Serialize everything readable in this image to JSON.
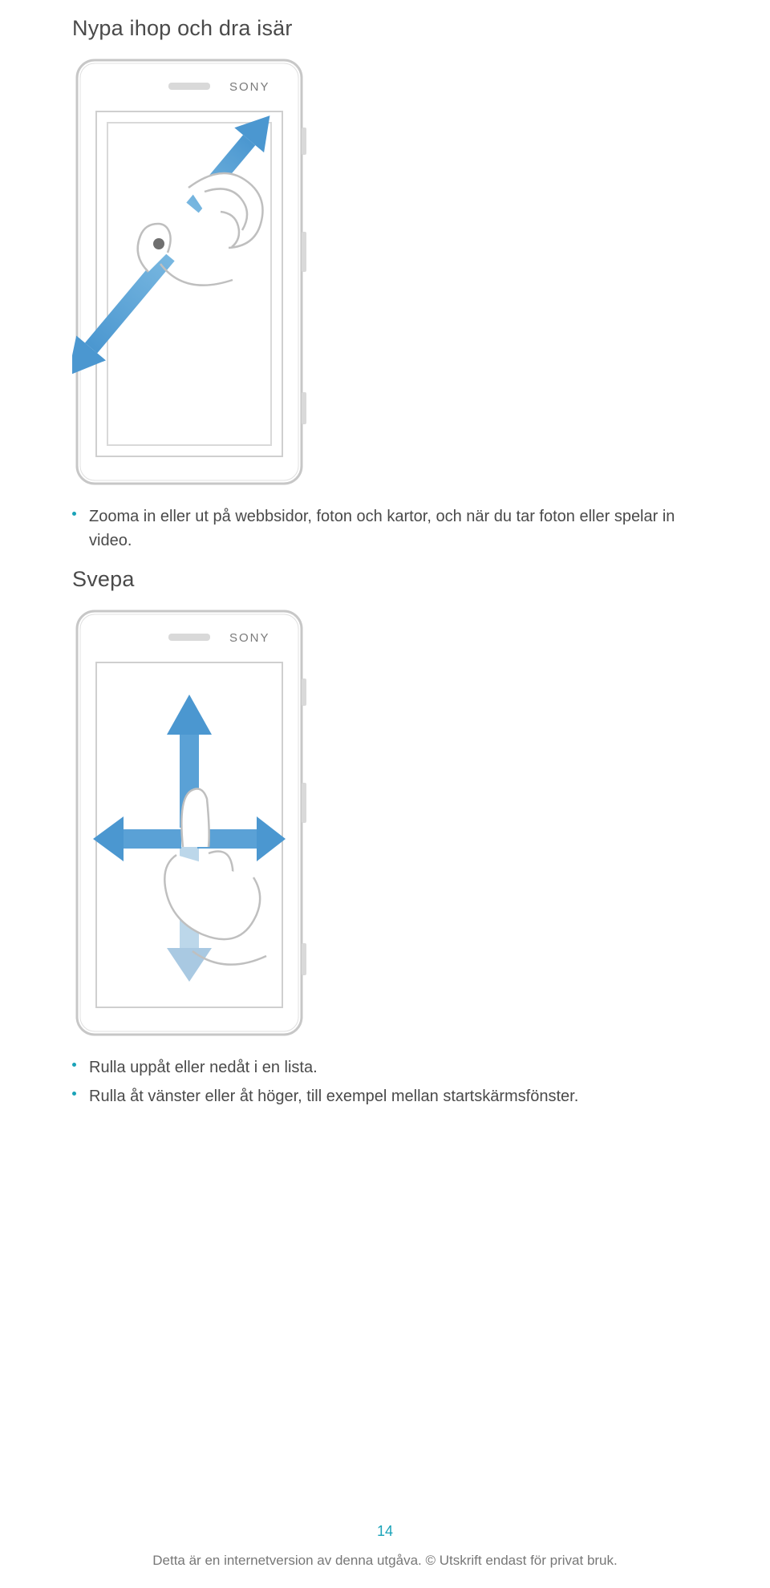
{
  "section1": {
    "heading": "Nypa ihop och dra isär",
    "bullet1": "Zooma in eller ut på webbsidor, foton och kartor, och när du tar foton eller spelar in video."
  },
  "section2": {
    "heading": "Svepa",
    "bullet1": "Rulla uppåt eller nedåt i en lista.",
    "bullet2": "Rulla åt vänster eller åt höger, till exempel mellan startskärmsfönster."
  },
  "devicebrand": "SONY",
  "page_number": "14",
  "footer": "Detta är en internetversion av denna utgåva. © Utskrift endast för privat bruk."
}
